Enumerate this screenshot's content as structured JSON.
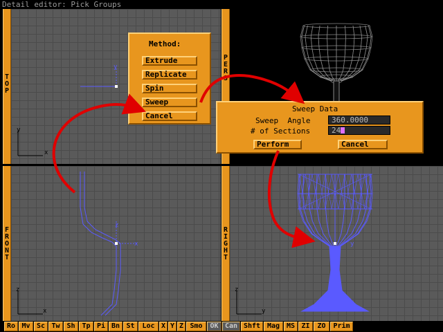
{
  "window": {
    "title": "Detail editor: Pick Groups"
  },
  "viewports": {
    "top": {
      "label": [
        "T",
        "O",
        "P"
      ],
      "axes": {
        "h": "x",
        "v": "y"
      }
    },
    "persp": {
      "label": [
        "P",
        "E",
        "R",
        "S",
        "P"
      ]
    },
    "front": {
      "label": [
        "F",
        "R",
        "O",
        "N",
        "T"
      ],
      "axes": {
        "h": "x",
        "v": "z"
      }
    },
    "right": {
      "label": [
        "R",
        "I",
        "G",
        "H",
        "T"
      ],
      "axes": {
        "h": "y",
        "v": "z"
      }
    }
  },
  "method_menu": {
    "title": "Method:",
    "items": [
      "Extrude",
      "Replicate",
      "Spin",
      "Sweep",
      "Cancel"
    ]
  },
  "sweep_dialog": {
    "title": "Sweep Data",
    "angle_label": "Sweep  Angle",
    "angle_value": "360.0000",
    "sections_label": "# of Sections",
    "sections_value": "24",
    "perform_label": "Perform",
    "cancel_label": "Cancel"
  },
  "toolbar": {
    "buttons": [
      "Ro",
      "Mv",
      "Sc",
      "Tw",
      "Sh",
      "Tp",
      "Pi",
      "Bn",
      "St",
      "Loc",
      "X",
      "Y",
      "Z",
      "Smo",
      "OK",
      "Can",
      "Shft",
      "Mag",
      "MS",
      "ZI",
      "ZO",
      "Prim"
    ],
    "active": [
      "OK",
      "Can"
    ]
  },
  "colors": {
    "panel": "#e8961e",
    "grid": "#5a5a5a",
    "arrow": "#e00000",
    "object": "#5a5aff"
  }
}
